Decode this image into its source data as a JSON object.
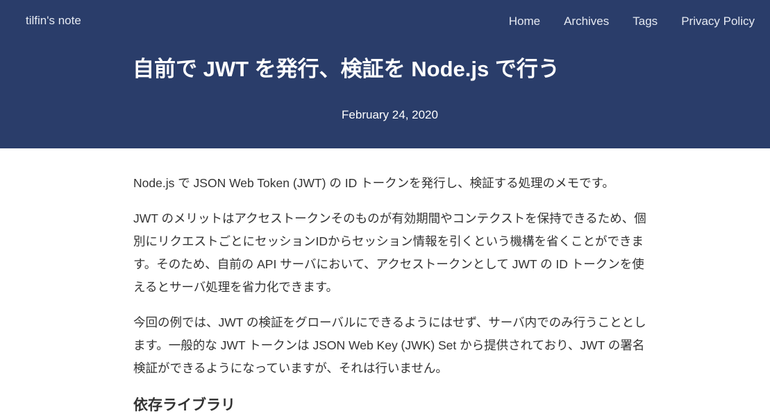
{
  "header": {
    "site_name": "tilfin's note",
    "nav": [
      {
        "label": "Home"
      },
      {
        "label": "Archives"
      },
      {
        "label": "Tags"
      },
      {
        "label": "Privacy Policy"
      }
    ]
  },
  "post": {
    "title": "自前で JWT を発行、検証を Node.js で行う",
    "date": "February 24, 2020",
    "paragraphs": [
      "Node.js で JSON Web Token (JWT) の ID トークンを発行し、検証する処理のメモです。",
      "JWT のメリットはアクセストークンそのものが有効期間やコンテクストを保持できるため、個別にリクエストごとにセッションIDからセッション情報を引くという機構を省くことができます。そのため、自前の API サーバにおいて、アクセストークンとして JWT の ID トークンを使えるとサーバ処理を省力化できます。",
      "今回の例では、JWT の検証をグローバルにできるようにはせず、サーバ内でのみ行うこととします。一般的な JWT トークンは JSON Web Key (JWK) Set から提供されており、JWT の署名検証ができるようになっていますが、それは行いません。"
    ],
    "section_heading": "依存ライブラリ"
  },
  "colors": {
    "header_background": "#2a3d6a",
    "header_text": "#ffffff",
    "body_text": "#333333"
  }
}
